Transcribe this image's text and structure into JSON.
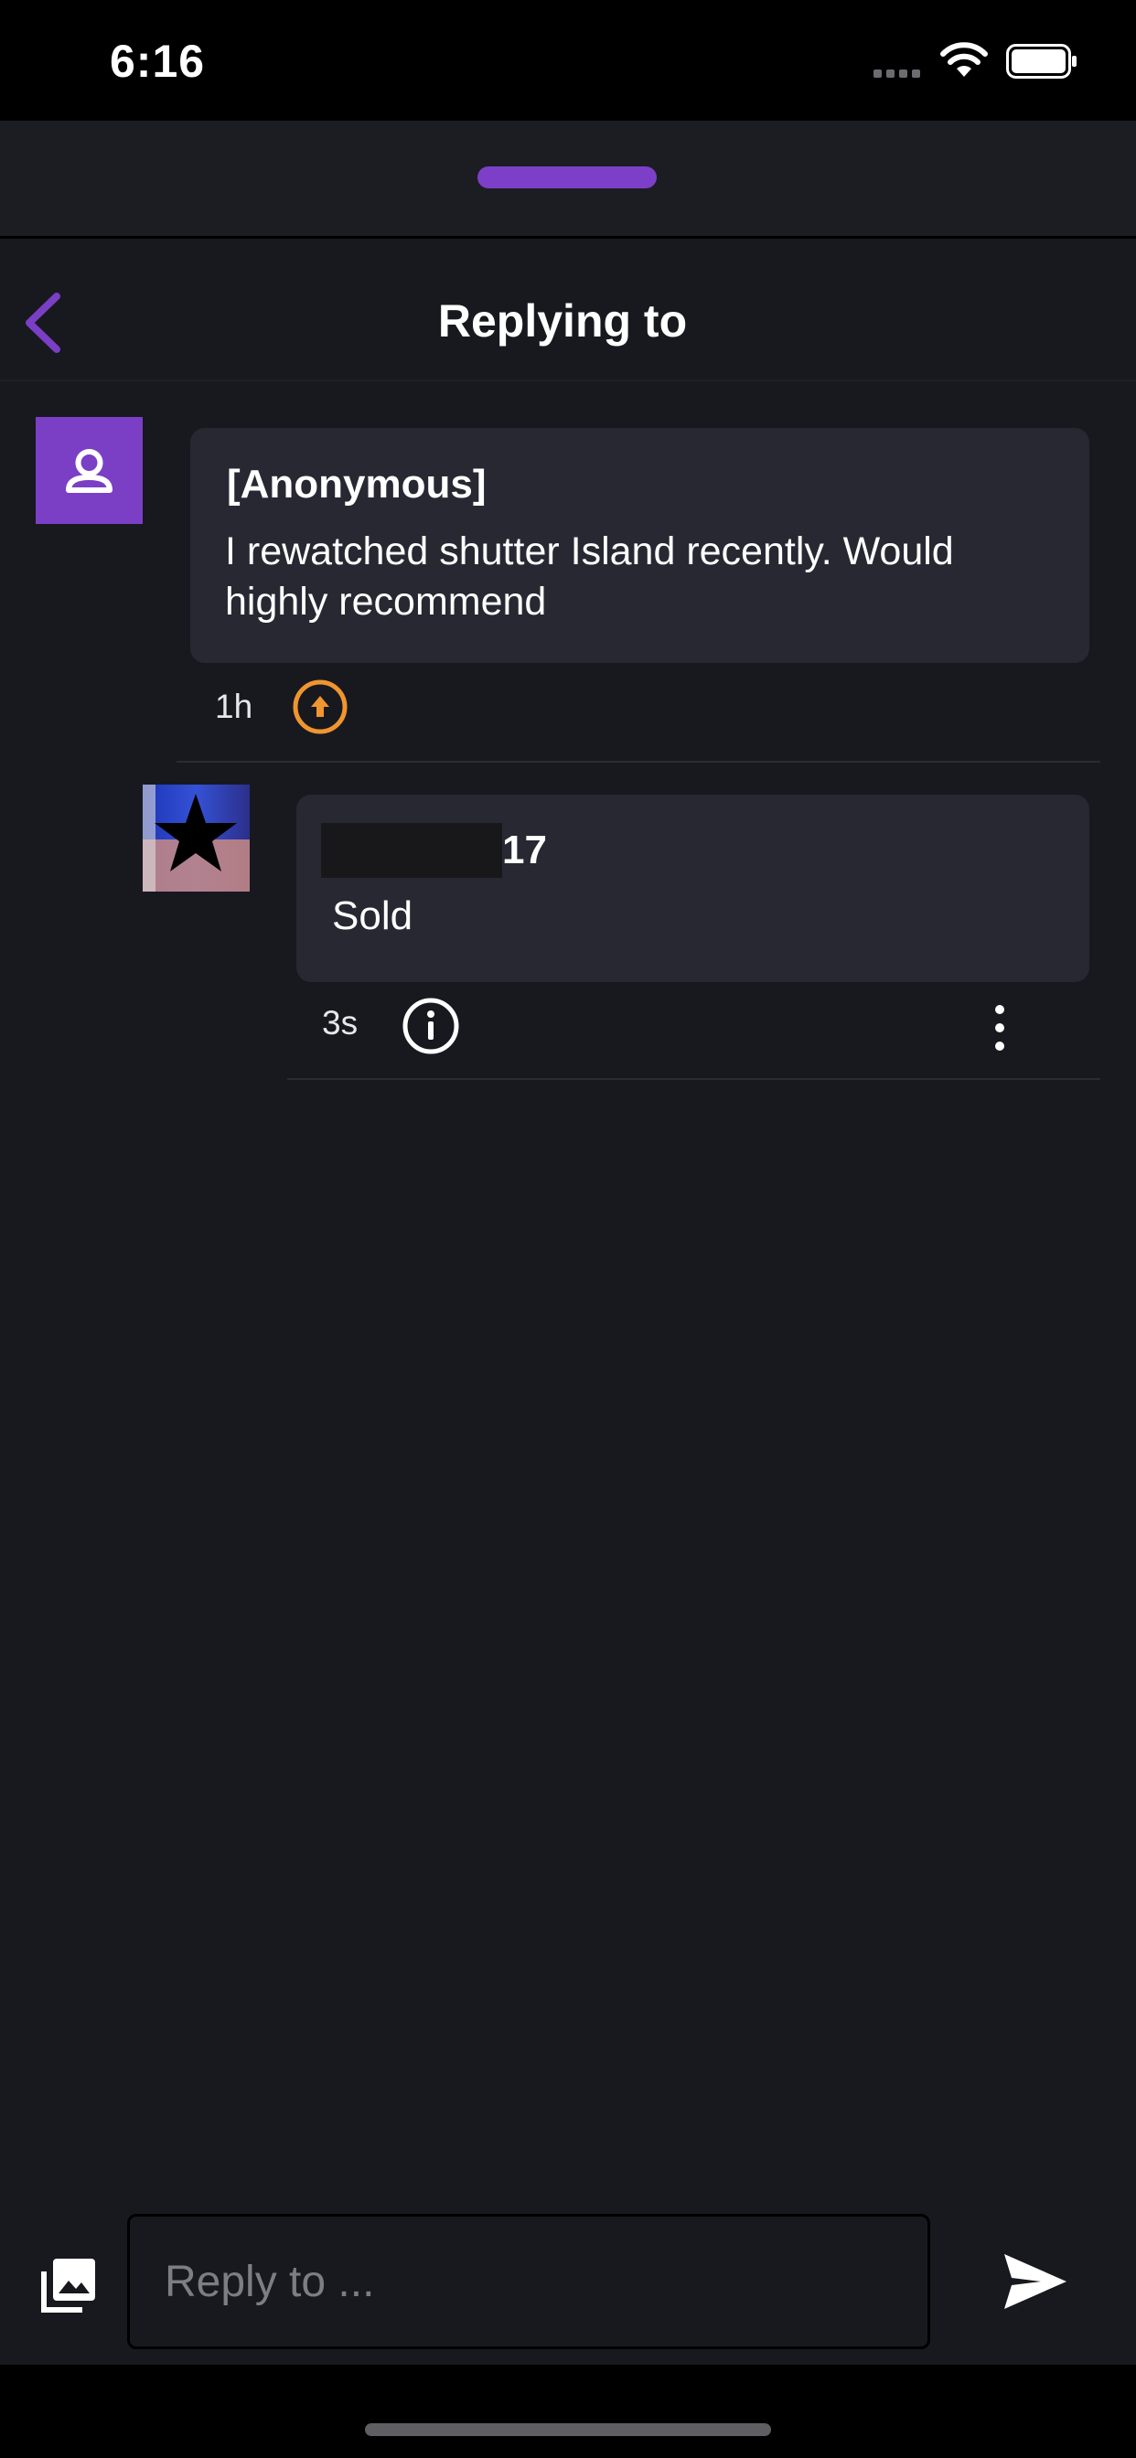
{
  "status_bar": {
    "time": "6:16"
  },
  "header": {
    "title": "Replying to"
  },
  "parent_comment": {
    "author": "[Anonymous]",
    "text": "I rewatched shutter Island recently. Would highly recommend",
    "age": "1h"
  },
  "reply": {
    "author_suffix": "17",
    "text": "Sold",
    "age": "3s"
  },
  "composer": {
    "placeholder": "Reply to ..."
  },
  "colors": {
    "accent": "#7b3fc6",
    "upvote": "#f0952f",
    "background": "#18191f",
    "bubble": "#282833"
  },
  "icons": {
    "back": "chevron-left-icon",
    "upvote": "arrow-up-circle-icon",
    "info": "info-circle-icon",
    "more": "vertical-dots-icon",
    "gallery": "photo-library-icon",
    "send": "send-icon"
  }
}
